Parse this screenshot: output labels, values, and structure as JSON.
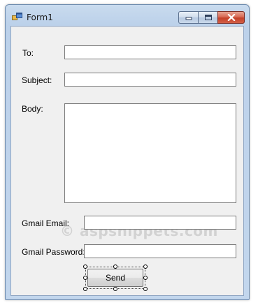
{
  "window": {
    "title": "Form1",
    "icons": {
      "app": "form-app-icon",
      "minimize": "minimize-icon",
      "maximize": "maximize-icon",
      "close": "close-icon"
    },
    "colors": {
      "client_background": "#f0f0f0",
      "close_button": "#c4412a",
      "frame": "#bcd1ea"
    }
  },
  "form": {
    "to_label": "To:",
    "to_value": "",
    "subject_label": "Subject:",
    "subject_value": "",
    "body_label": "Body:",
    "body_value": "",
    "gmail_email_label": "Gmail Email:",
    "gmail_email_value": "",
    "gmail_password_label": "Gmail Password:",
    "gmail_password_value": "",
    "send_label": "Send"
  },
  "watermark": "© aspsnippets.com"
}
